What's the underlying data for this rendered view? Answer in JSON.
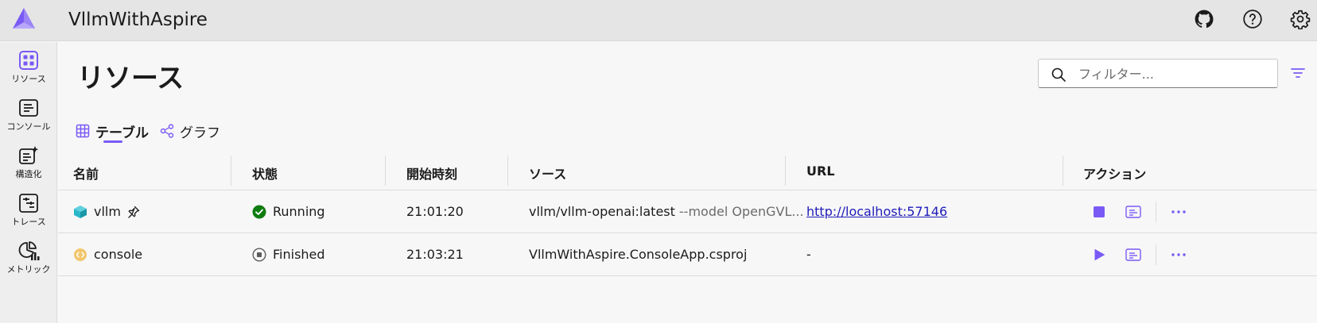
{
  "header": {
    "title": "VllmWithAspire",
    "icons": [
      "github-icon",
      "help-icon",
      "settings-icon"
    ]
  },
  "sidebar": {
    "items": [
      {
        "label": "リソース",
        "icon": "resources-grid-icon",
        "active": true
      },
      {
        "label": "コンソール",
        "icon": "console-icon"
      },
      {
        "label": "構造化",
        "icon": "structured-logs-icon"
      },
      {
        "label": "トレース",
        "icon": "traces-icon"
      },
      {
        "label": "メトリック",
        "icon": "metrics-icon"
      }
    ]
  },
  "page": {
    "title": "リソース",
    "filter_placeholder": "フィルター...",
    "tabs": [
      {
        "label": "テーブル",
        "icon": "table-icon",
        "active": true
      },
      {
        "label": "グラフ",
        "icon": "graph-icon",
        "active": false
      }
    ]
  },
  "table": {
    "columns": [
      "名前",
      "状態",
      "開始時刻",
      "ソース",
      "URL",
      "アクション"
    ],
    "rows": [
      {
        "name": "vllm",
        "type_icon": "container-cube-icon",
        "pinned": true,
        "state": "Running",
        "state_icon": "running-check-icon",
        "start_time": "21:01:20",
        "source": "vllm/vllm-openai:latest",
        "source_args": "--model OpenGVL...",
        "url": "http://localhost:57146",
        "action_primary": "stop-icon"
      },
      {
        "name": "console",
        "type_icon": "project-icon",
        "pinned": false,
        "state": "Finished",
        "state_icon": "finished-stop-icon",
        "start_time": "21:03:21",
        "source": "VllmWithAspire.ConsoleApp.csproj",
        "source_args": "",
        "url": "-",
        "action_primary": "start-icon"
      }
    ]
  },
  "colors": {
    "accent": "#7a5af5",
    "running": "#107c10",
    "link": "#1f1bb8",
    "project_icon": "#f2c66d",
    "container_icon": "#2ab7c9"
  }
}
